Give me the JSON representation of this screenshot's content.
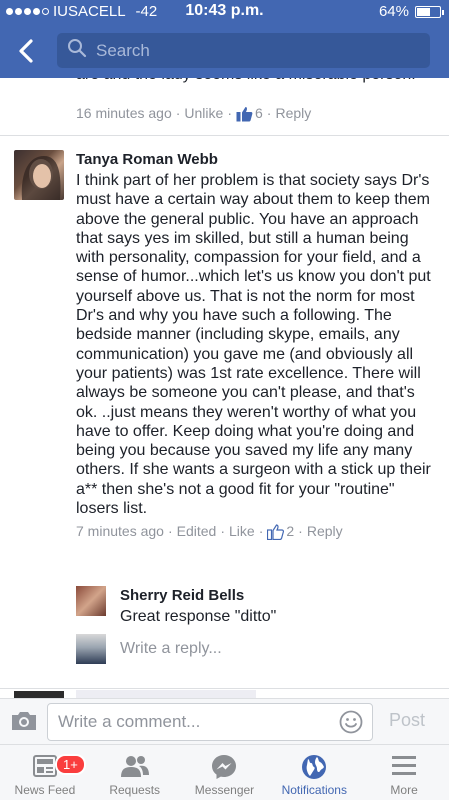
{
  "status_bar": {
    "carrier": "IUSACELL",
    "signal_level": "-42",
    "time": "10:43 p.m.",
    "battery": "64%",
    "battery_fraction": 0.64
  },
  "header": {
    "search_placeholder": "Search"
  },
  "previous_comment": {
    "text_tail": "are and the lady seems like a miserable person.",
    "time": "16 minutes ago",
    "unlike_label": "Unlike",
    "likes": "6",
    "reply_label": "Reply"
  },
  "comment": {
    "author": "Tanya Roman Webb",
    "text": "I think part of her problem is that society says Dr's must have a certain way about them to keep them above the general public. You have an approach that says yes im skilled,  but still a human being with personality, compassion for your field, and a sense of humor...which let's us know you don't put yourself above us. That is not the norm for most Dr's and why you have such a following. The bedside manner (including skype, emails, any communication) you gave me (and obviously all your patients) was 1st rate excellence. There will always be someone you can't please, and that's ok. ..just means they weren't worthy of what you have to offer. Keep doing what you're doing and being you because you saved my life any many others. If she wants a surgeon with a stick up their a** then she's not a good fit for your \"routine\" losers list.",
    "time": "7 minutes ago",
    "edited_label": "Edited",
    "like_label": "Like",
    "likes": "2",
    "reply_label": "Reply"
  },
  "reply": {
    "author": "Sherry Reid Bells",
    "text": "Great response \"ditto\""
  },
  "write_reply": {
    "placeholder": "Write a reply..."
  },
  "composer": {
    "placeholder": "Write a comment...",
    "post_label": "Post"
  },
  "tabs": [
    {
      "label": "News Feed",
      "icon": "news-feed-icon",
      "badge": "1+"
    },
    {
      "label": "Requests",
      "icon": "friends-icon"
    },
    {
      "label": "Messenger",
      "icon": "messenger-icon"
    },
    {
      "label": "Notifications",
      "icon": "globe-icon",
      "active": true
    },
    {
      "label": "More",
      "icon": "menu-icon"
    }
  ],
  "colors": {
    "brand": "#4267b2",
    "meta": "#90949c",
    "badge": "#fa3e3e"
  }
}
